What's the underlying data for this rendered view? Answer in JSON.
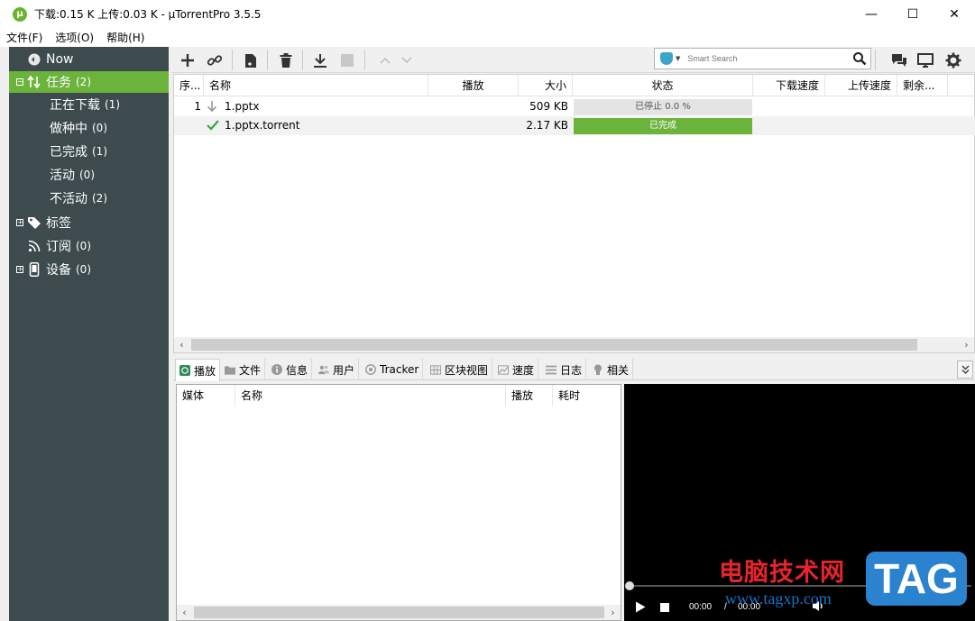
{
  "window": {
    "title": "下载:0.15 K 上传:0.03 K - µTorrentPro 3.5.5",
    "app_icon": "µ",
    "minimize": "—",
    "maximize": "☐",
    "close": "✕"
  },
  "menu": [
    "文件(F)",
    "选项(O)",
    "帮助(H)"
  ],
  "sidebar": {
    "now": "Now",
    "tasks": {
      "label": "任务",
      "count": "(2)",
      "expander": "−"
    },
    "filters": [
      {
        "label": "正在下载",
        "count": "(1)"
      },
      {
        "label": "做种中",
        "count": "(0)"
      },
      {
        "label": "已完成",
        "count": "(1)"
      },
      {
        "label": "活动",
        "count": "(0)"
      },
      {
        "label": "不活动",
        "count": "(2)"
      }
    ],
    "tags": {
      "label": "标签",
      "expander": "+"
    },
    "feeds": {
      "label": "订阅",
      "count": "(0)"
    },
    "devices": {
      "label": "设备",
      "count": "(0)",
      "expander": "+"
    }
  },
  "search": {
    "placeholder": "Smart Search"
  },
  "torrent_table": {
    "columns": [
      "序...",
      "名称",
      "播放",
      "大小",
      "状态",
      "下载速度",
      "上传速度",
      "剩余..."
    ],
    "rows": [
      {
        "seq": "1",
        "name": "1.pptx",
        "size": "509 KB",
        "status": "已停止 0.0 %",
        "progress": 0.0,
        "state": "stopped"
      },
      {
        "seq": "",
        "name": "1.pptx.torrent",
        "size": "2.17 KB",
        "status": "已完成",
        "progress": 1.0,
        "state": "completed"
      }
    ]
  },
  "detail_tabs": [
    "播放",
    "文件",
    "信息",
    "用户",
    "Tracker",
    "区块视图",
    "速度",
    "日志",
    "相关"
  ],
  "media_table": {
    "columns": [
      "媒体",
      "名称",
      "播放",
      "耗时"
    ]
  },
  "player": {
    "current_time": "00:00",
    "separator": "/",
    "total_time": "00:00",
    "progress": 0.0
  },
  "watermark": {
    "title": "电脑技术网",
    "url": "www.tagxp.com",
    "badge": "TAG"
  },
  "colors": {
    "accent_green": "#6bb33b",
    "sidebar_bg": "#3d4b4f",
    "stopped_bar": "#e4e4e4"
  }
}
